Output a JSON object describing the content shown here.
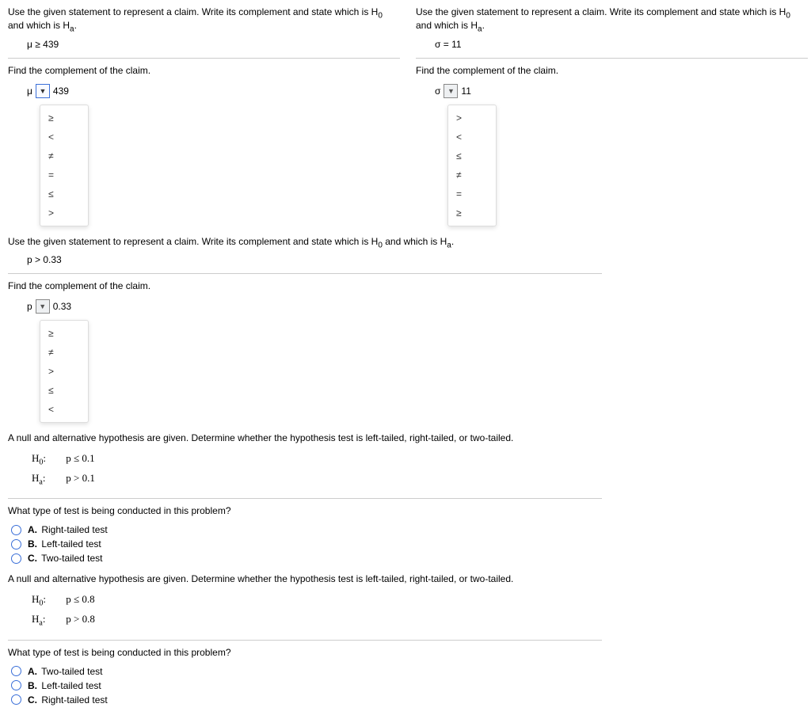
{
  "q1": {
    "prompt_prefix": "Use the given statement to represent a claim. Write its complement and state which is H",
    "prompt_mid": " and which is H",
    "prompt_end": ".",
    "claim": "μ ≥ 439",
    "find": "Find the complement of the claim.",
    "param": "μ",
    "value": "439",
    "options": [
      "≥",
      "<",
      "≠",
      "=",
      "≤",
      ">"
    ]
  },
  "q2": {
    "prompt_prefix": "Use the given statement to represent a claim. Write its complement and state which is H",
    "prompt_mid": " and which is H",
    "prompt_end": ".",
    "claim": "σ = 11",
    "find": "Find the complement of the claim.",
    "param": "σ",
    "value": "11",
    "options": [
      ">",
      "<",
      "≤",
      "≠",
      "=",
      "≥"
    ]
  },
  "q3": {
    "prompt_prefix": "Use the given statement to represent a claim. Write its complement and state which is H",
    "prompt_mid": " and which is H",
    "prompt_end": ".",
    "claim": "p > 0.33",
    "find": "Find the complement of the claim.",
    "param": "p",
    "value": "0.33",
    "options": [
      "≥",
      "≠",
      ">",
      "≤",
      "<"
    ]
  },
  "q4": {
    "prompt": "A null and alternative hypothesis are given. Determine whether the hypothesis test is left-tailed, right-tailed, or two-tailed.",
    "h0_label": "H",
    "h0_inner": "p  ≤  0.1",
    "ha_label": "H",
    "ha_inner": "p  >  0.1",
    "question": "What type of test is being conducted in this problem?",
    "options": {
      "A": "Right-tailed test",
      "B": "Left-tailed test",
      "C": "Two-tailed test"
    }
  },
  "q5": {
    "prompt": "A null and alternative hypothesis are given. Determine whether the hypothesis test is left-tailed, right-tailed, or two-tailed.",
    "h0_label": "H",
    "h0_inner": "p  ≤  0.8",
    "ha_label": "H",
    "ha_inner": "p  >  0.8",
    "question": "What type of test is being conducted in this problem?",
    "options": {
      "A": "Two-tailed test",
      "B": "Left-tailed test",
      "C": "Right-tailed test"
    }
  },
  "letters": {
    "A": "A.",
    "B": "B.",
    "C": "C."
  },
  "sub0": "0",
  "suba": "a"
}
